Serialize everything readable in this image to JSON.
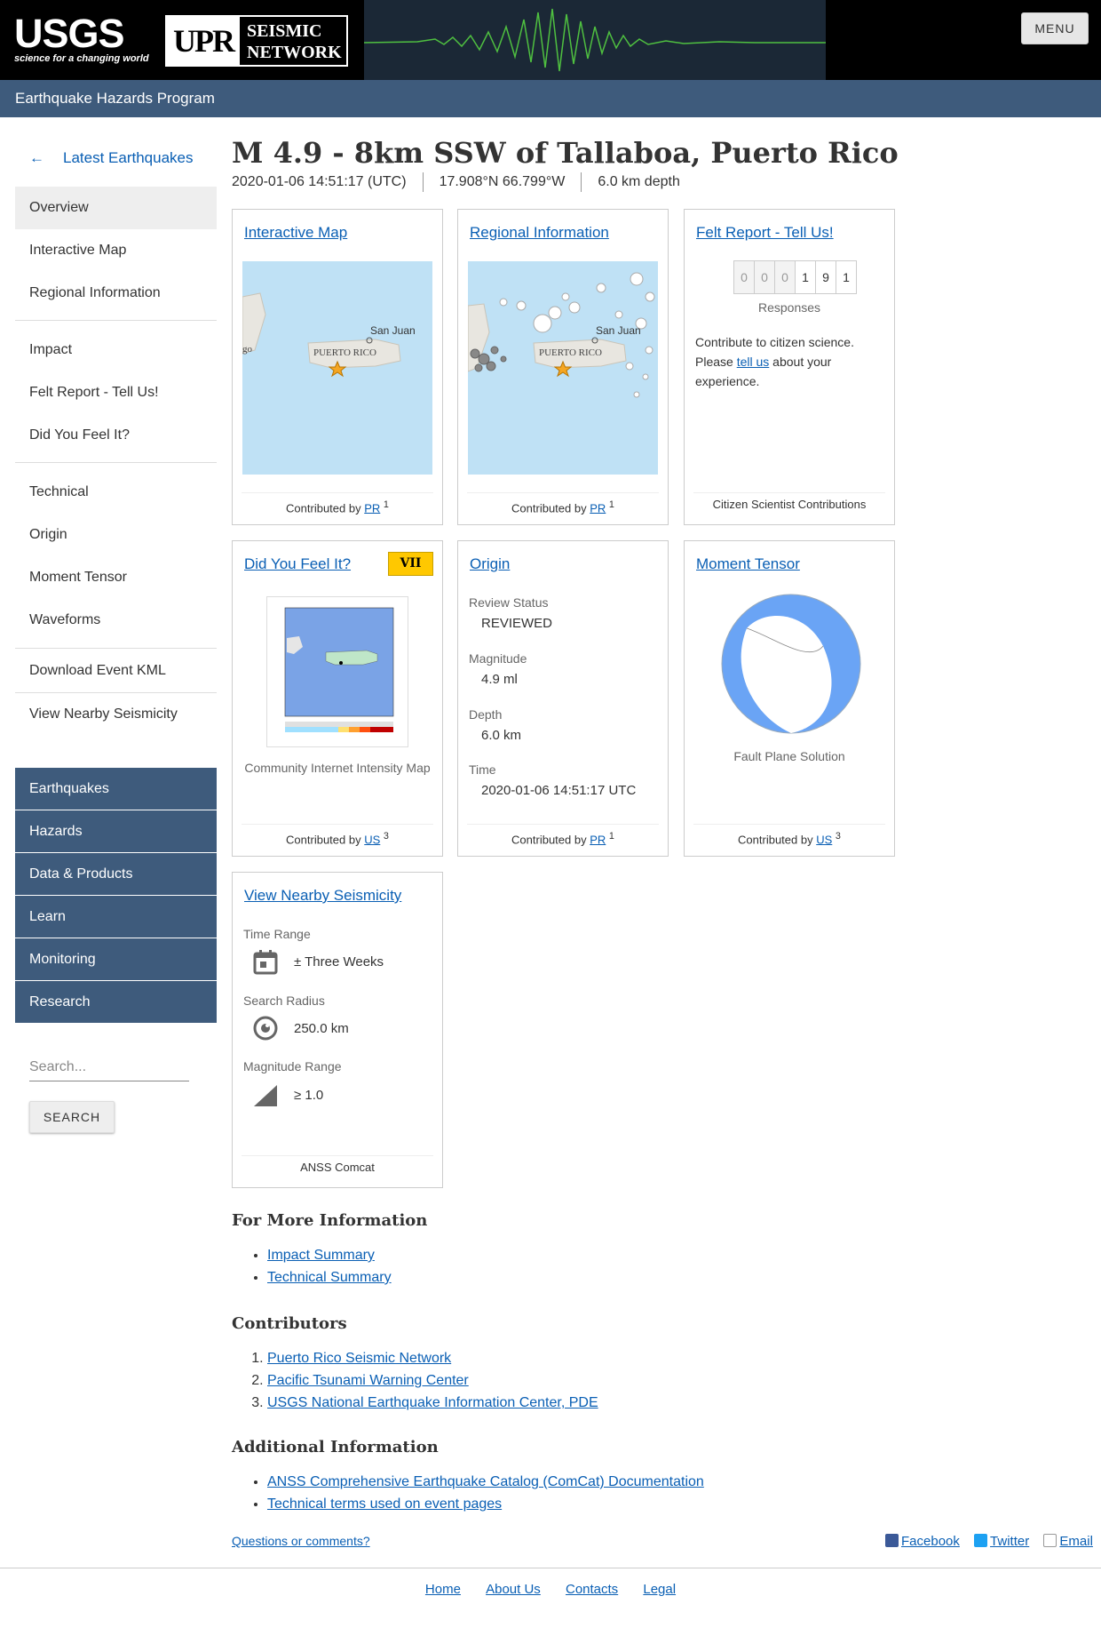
{
  "header": {
    "usgs_word": "USGS",
    "usgs_tagline": "science for a changing world",
    "upr_mark": "UPR",
    "network_line1": "SEISMIC",
    "network_line2": "NETWORK",
    "menu_label": "MENU",
    "program": "Earthquake Hazards Program"
  },
  "sidebar": {
    "back_arrow": "←",
    "back_label": "Latest Earthquakes",
    "group1": [
      "Overview",
      "Interactive Map",
      "Regional Information"
    ],
    "group2": [
      "Impact",
      "Felt Report - Tell Us!",
      "Did You Feel It?"
    ],
    "group3": [
      "Technical",
      "Origin",
      "Moment Tensor",
      "Waveforms"
    ],
    "download_kml": "Download Event KML",
    "nearby": "View Nearby Seismicity",
    "nav": [
      "Earthquakes",
      "Hazards",
      "Data & Products",
      "Learn",
      "Monitoring",
      "Research"
    ],
    "search_placeholder": "Search...",
    "search_button": "SEARCH"
  },
  "event": {
    "title": "M 4.9 - 8km SSW of Tallaboa, Puerto Rico",
    "time": "2020-01-06 14:51:17 (UTC)",
    "location": "17.908°N 66.799°W",
    "depth": "6.0 km depth"
  },
  "cards": {
    "interactive_map": {
      "title": "Interactive Map",
      "contrib_prefix": "Contributed by",
      "contrib_src": "PR",
      "contrib_num": "1",
      "label_san_juan": "San Juan",
      "label_puerto_rico": "PUERTO RICO",
      "label_edge": "go"
    },
    "regional": {
      "title": "Regional Information",
      "contrib_prefix": "Contributed by",
      "contrib_src": "PR",
      "contrib_num": "1",
      "label_san_juan": "San Juan",
      "label_puerto_rico": "PUERTO RICO"
    },
    "felt": {
      "title": "Felt Report - Tell Us!",
      "digits": [
        "0",
        "0",
        "0",
        "1",
        "9",
        "1"
      ],
      "responses": "Responses",
      "text_before": "Contribute to citizen science. Please ",
      "link": "tell us",
      "text_after": " about your experience.",
      "footer": "Citizen Scientist Contributions"
    },
    "dyfi": {
      "title": "Did You Feel It?",
      "intensity": "VII",
      "caption": "Community Internet Intensity Map",
      "contrib_prefix": "Contributed by",
      "contrib_src": "US",
      "contrib_num": "3",
      "intensity_color": "#ffc800"
    },
    "origin": {
      "title": "Origin",
      "review_label": "Review Status",
      "review_value": "REVIEWED",
      "mag_label": "Magnitude",
      "mag_value": "4.9 ml",
      "depth_label": "Depth",
      "depth_value": "6.0 km",
      "time_label": "Time",
      "time_value": "2020-01-06 14:51:17 UTC",
      "contrib_prefix": "Contributed by",
      "contrib_src": "PR",
      "contrib_num": "1"
    },
    "moment": {
      "title": "Moment Tensor",
      "caption": "Fault Plane Solution",
      "contrib_prefix": "Contributed by",
      "contrib_src": "US",
      "contrib_num": "3",
      "beachball_color": "#6aa4f5"
    },
    "nearby": {
      "title": "View Nearby Seismicity",
      "time_label": "Time Range",
      "time_value": "± Three Weeks",
      "radius_label": "Search Radius",
      "radius_value": "250.0 km",
      "mag_label": "Magnitude Range",
      "mag_value": "≥ 1.0",
      "footer": "ANSS Comcat"
    }
  },
  "more_info": {
    "heading": "For More Information",
    "links": [
      "Impact Summary",
      "Technical Summary"
    ]
  },
  "contributors": {
    "heading": "Contributors",
    "links": [
      "Puerto Rico Seismic Network",
      "Pacific Tsunami Warning Center",
      "USGS National Earthquake Information Center, PDE"
    ]
  },
  "additional": {
    "heading": "Additional Information",
    "links": [
      "ANSS Comprehensive Earthquake Catalog (ComCat) Documentation",
      "Technical terms used on event pages"
    ]
  },
  "bottom": {
    "questions": "Questions or comments?",
    "facebook": "Facebook",
    "twitter": "Twitter",
    "email": "Email"
  },
  "footer": {
    "links": [
      "Home",
      "About Us",
      "Contacts",
      "Legal"
    ]
  },
  "colors": {
    "header_bg": "#000000",
    "program_bar": "#3e5b7c",
    "link": "#0a5fb4"
  }
}
